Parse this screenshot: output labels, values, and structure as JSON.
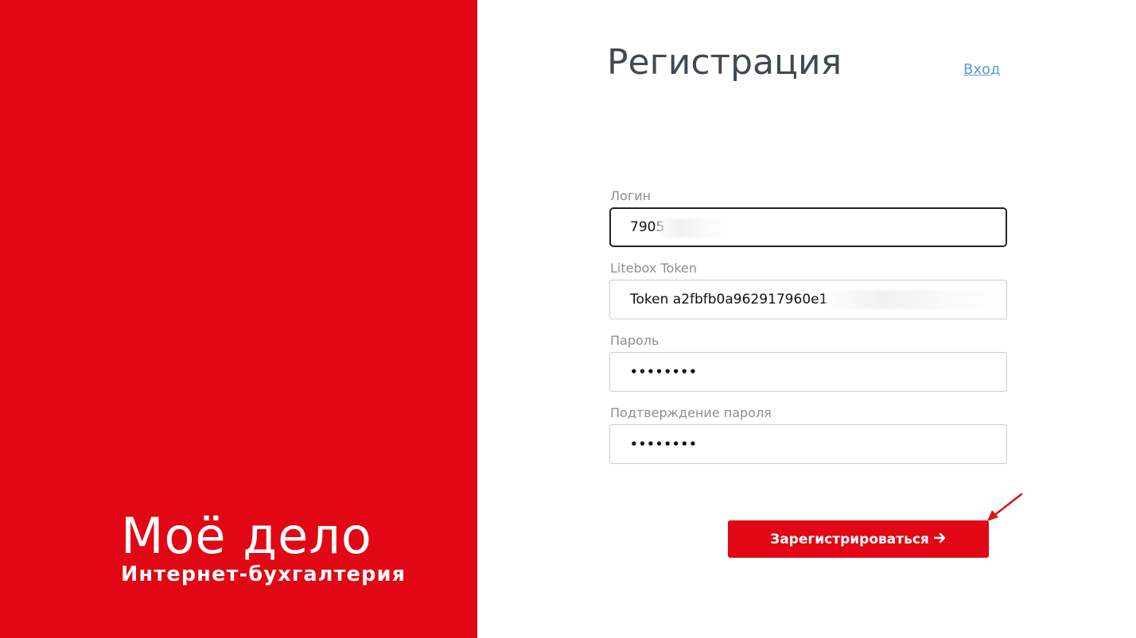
{
  "brand": {
    "name": "Моё дело",
    "subtitle": "Интернет-бухгалтерия"
  },
  "form": {
    "title": "Регистрация",
    "login_link": "Вход",
    "fields": [
      {
        "label": "Логин",
        "value": "7905",
        "masked": true
      },
      {
        "label": "Litebox Token",
        "value": "Token a2fbfb0a962917960e1",
        "masked": true
      },
      {
        "label": "Пароль",
        "value": "••••••••"
      },
      {
        "label": "Подтверждение пароля",
        "value": "••••••••"
      }
    ],
    "submit_label": "Зарегистрироваться",
    "submit_icon": "arrow-right-icon"
  },
  "colors": {
    "brand_red": "#e10714",
    "title": "#3f4a53",
    "link": "#5e9ce0",
    "label": "#8a8f94"
  }
}
